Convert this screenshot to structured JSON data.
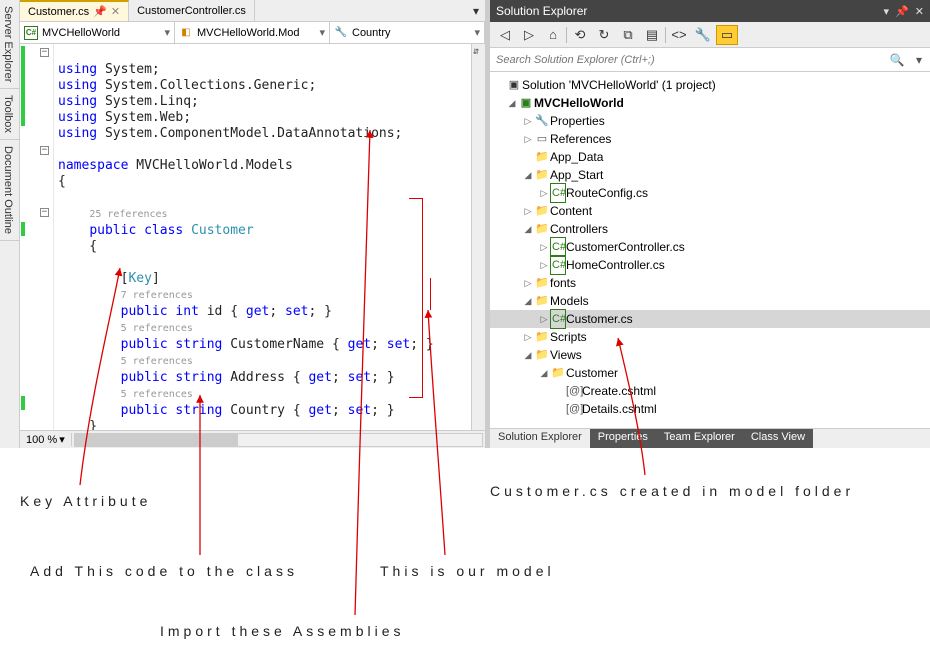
{
  "editor": {
    "tabs": [
      {
        "label": "Customer.cs",
        "active": true,
        "pinnable": true
      },
      {
        "label": "CustomerController.cs",
        "active": false
      }
    ],
    "nav": {
      "project": "MVCHelloWorld",
      "class": "MVCHelloWorld.Mod",
      "member": "Country"
    },
    "zoom": "100 %",
    "code": {
      "usings": [
        "using System;",
        "using System.Collections.Generic;",
        "using System.Linq;",
        "using System.Web;",
        "using System.ComponentModel.DataAnnotations;"
      ],
      "ns_line": "namespace MVCHelloWorld.Models",
      "open_brace": "{",
      "class_refcount": "25 references",
      "class_decl_pre": "public class ",
      "class_decl_name": "Customer",
      "class_open": "{",
      "key_attr": "[Key]",
      "id_ref": "7 references",
      "id_line_a": "public int id { ",
      "id_line_b": "get; set; }",
      "name_ref": "5 references",
      "name_line_a": "public string CustomerName { ",
      "name_line_b": "get; set; }",
      "addr_ref": "5 references",
      "addr_line_a": "public string Address { ",
      "addr_line_b": "get; set; }",
      "ctry_ref": "5 references",
      "ctry_line_a": "public string Country { ",
      "ctry_line_b": "get; set; }",
      "class_close": "}"
    }
  },
  "solution_explorer": {
    "title": "Solution Explorer",
    "search_placeholder": "Search Solution Explorer (Ctrl+;)",
    "solution_label": "Solution 'MVCHelloWorld' (1 project)",
    "project": "MVCHelloWorld",
    "nodes": {
      "properties": "Properties",
      "references": "References",
      "app_data": "App_Data",
      "app_start": "App_Start",
      "routeconfig": "RouteConfig.cs",
      "content": "Content",
      "controllers": "Controllers",
      "custctrl": "CustomerController.cs",
      "homectrl": "HomeController.cs",
      "fonts": "fonts",
      "models": "Models",
      "customer_cs": "Customer.cs",
      "scripts": "Scripts",
      "views": "Views",
      "cust_folder": "Customer",
      "create_v": "Create.cshtml",
      "details_v": "Details.cshtml"
    },
    "bottom_tabs": [
      "Solution Explorer",
      "Properties",
      "Team Explorer",
      "Class View"
    ]
  },
  "left_tools": [
    "Server Explorer",
    "Toolbox",
    "Document Outline"
  ],
  "annotations": {
    "key_attr": "Key Attribute",
    "add_code": "Add This code to the class",
    "import": "Import these Assemblies",
    "model": "This is our model",
    "created": "Customer.cs created in model folder"
  }
}
